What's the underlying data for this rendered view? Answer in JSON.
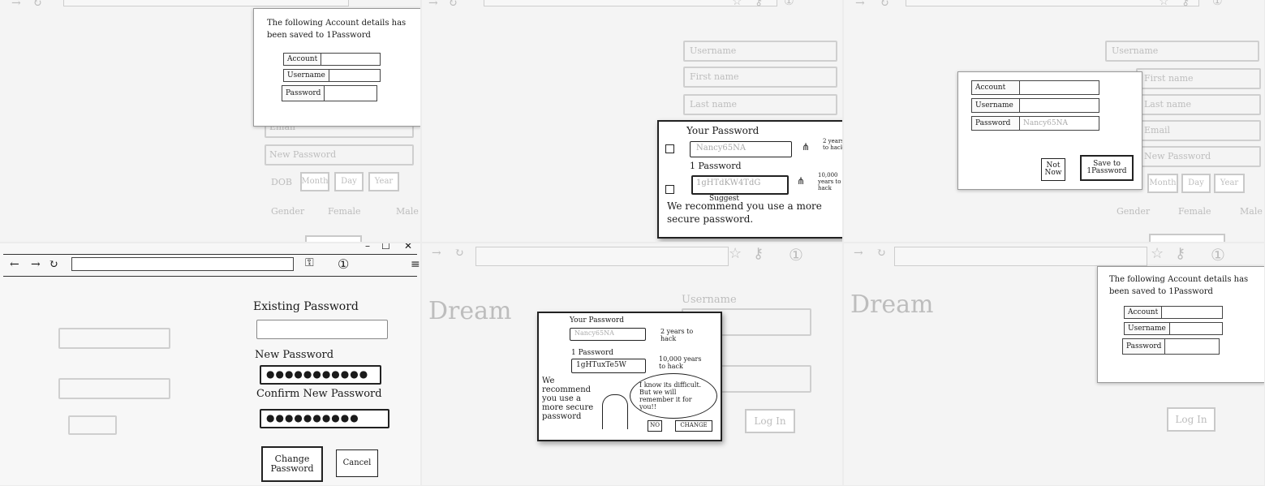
{
  "panels": {
    "p1": {
      "card_message": "The following Account details has been saved to 1Password",
      "fields": [
        "Account",
        "Username",
        "Password"
      ],
      "bg_fields": [
        "Email",
        "New Password"
      ],
      "dob_label": "DOB",
      "dob_parts": [
        "Month",
        "Day",
        "Year"
      ],
      "gender_label": "Gender",
      "gender_options": [
        "Female",
        "Male"
      ]
    },
    "p2": {
      "bg_fields": [
        "Username",
        "First name",
        "Last name"
      ],
      "your_password_label": "Your Password",
      "your_password_value": "Nancy65NA",
      "your_password_crack": "2 years to hack",
      "onepw_label": "1 Password",
      "onepw_value": "1gHTdKW4TdG",
      "onepw_crack": "10,000 years to hack",
      "suggest": "Suggest",
      "recommend": "We recommend you use a more secure password."
    },
    "p3": {
      "bg_fields": [
        "Username",
        "First name",
        "Last name",
        "Email",
        "New Password"
      ],
      "fields": [
        {
          "label": "Account",
          "value": ""
        },
        {
          "label": "Username",
          "value": ""
        },
        {
          "label": "Password",
          "value": "Nancy65NA"
        }
      ],
      "not_now": "Not Now",
      "save": "Save to 1Password",
      "dob_parts": [
        "Month",
        "Day",
        "Year"
      ],
      "gender_label": "Gender",
      "gender_options": [
        "Female",
        "Male"
      ]
    },
    "p4": {
      "existing_label": "Existing Password",
      "new_label": "New Password",
      "new_value": "●●●●●●●●●●●",
      "confirm_label": "Confirm New Password",
      "confirm_value": "●●●●●●●●●●",
      "change_button": "Change Password",
      "cancel_button": "Cancel"
    },
    "p5": {
      "bg_title": "Dream",
      "bg_field": "Username",
      "login": "Log In",
      "your_password_label": "Your Password",
      "your_password_value": "Nancy65NA",
      "your_password_crack": "2 years to hack",
      "onepw_label": "1 Password",
      "onepw_value": "1gHTuxTe5W",
      "onepw_crack": "10,000 years to hack",
      "recommend": "We recommend you use a more secure password",
      "bubble": "I know its difficult. But we will remember it for you!!",
      "no_button": "NO",
      "change_button": "CHANGE"
    },
    "p6": {
      "bg_title": "Dream",
      "card_message": "The following Account details has been saved to 1Password",
      "fields": [
        "Account",
        "Username",
        "Password"
      ],
      "login": "Log In"
    }
  }
}
